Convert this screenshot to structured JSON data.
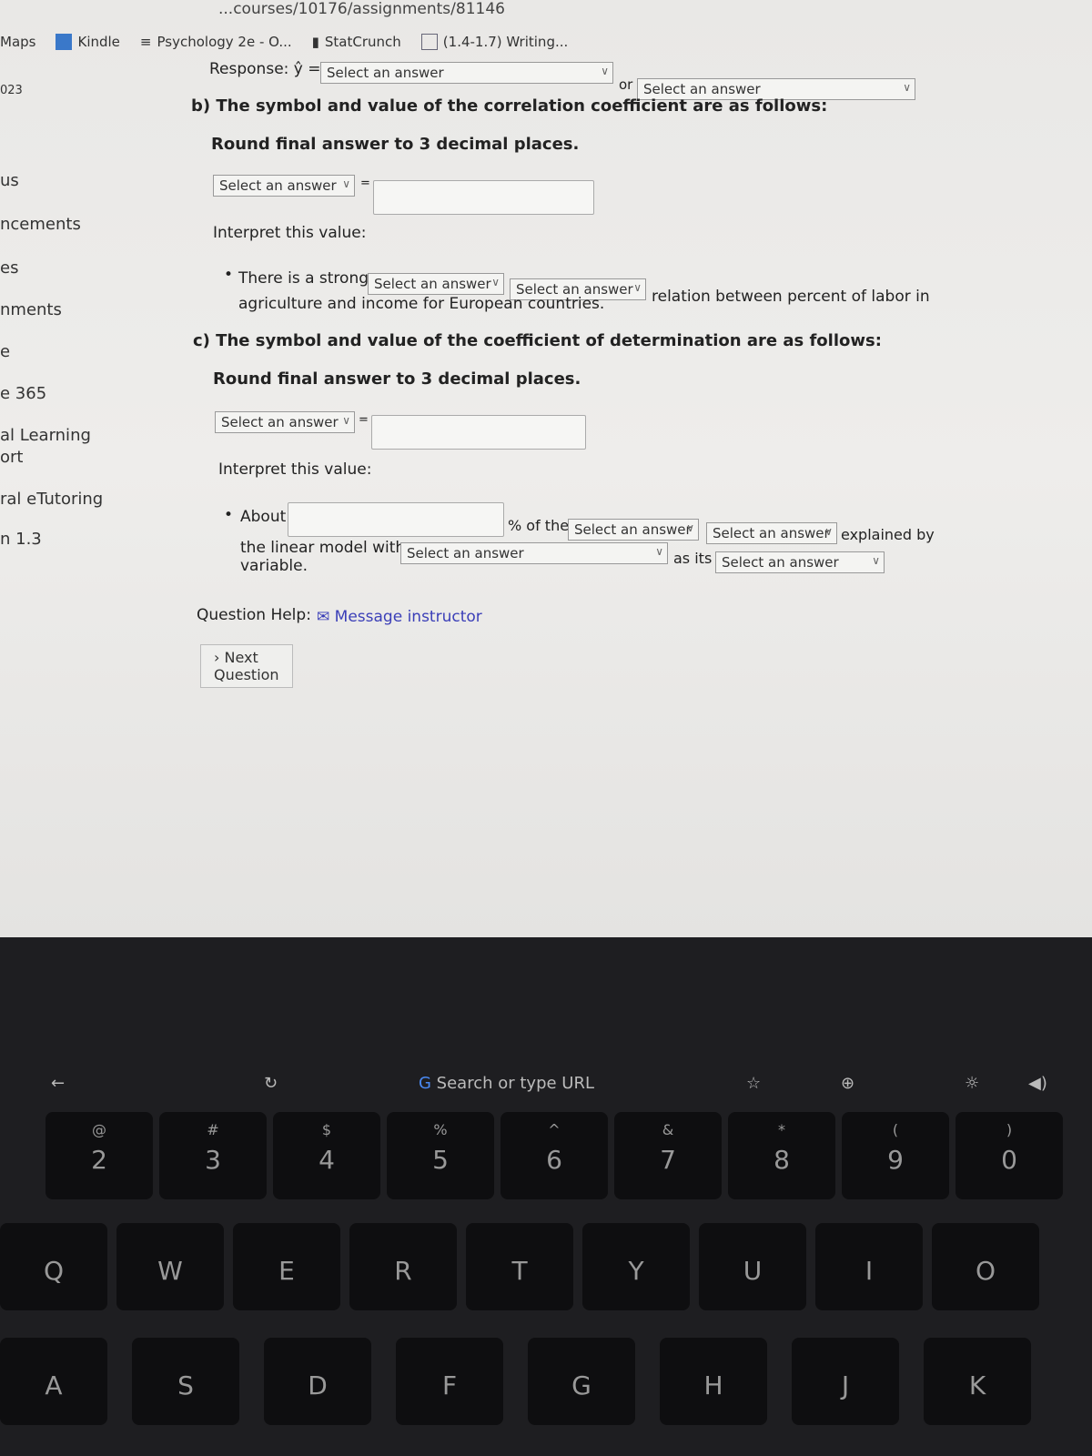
{
  "browser": {
    "url": "...courses/10176/assignments/81146",
    "bookmarks": [
      {
        "label": "Maps"
      },
      {
        "label": "Kindle"
      },
      {
        "label": "Psychology 2e - O..."
      },
      {
        "label": "StatCrunch"
      },
      {
        "label": "(1.4-1.7) Writing..."
      }
    ]
  },
  "sidebar": {
    "items": [
      "023",
      "us",
      "ncements",
      "es",
      "nments",
      "e",
      "e 365",
      "al Learning",
      "ort",
      "ral eTutoring",
      "n 1.3"
    ]
  },
  "question": {
    "response_label": "Response: ŷ =",
    "select_placeholder": "Select an answer",
    "or_text": "or",
    "part_b": {
      "heading": "b) The symbol and value of the correlation coefficient are as follows:",
      "round": "Round final answer to 3 decimal places.",
      "equals": "=",
      "interpret": "Interpret this value:",
      "bullet_pre": "There is a strong",
      "bullet_post": "relation between percent of labor in",
      "bullet_line2": "agriculture and income for European countries."
    },
    "part_c": {
      "heading": "c) The symbol and value of the coefficient of determination are as follows:",
      "round": "Round final answer to 3 decimal places.",
      "equals": "=",
      "interpret": "Interpret this value:",
      "about": "About",
      "pct_of_the": "% of the",
      "explained_by": "explained by",
      "line2_pre": "the linear model with",
      "as_its": "as its",
      "line3": "variable."
    },
    "help_label": "Question Help:",
    "message_instructor": "Message instructor",
    "next_question": "Next Question"
  },
  "touchbar": {
    "search": "Search or type URL"
  },
  "keyboard": {
    "number_row": [
      {
        "top": "@",
        "main": "2"
      },
      {
        "top": "#",
        "main": "3"
      },
      {
        "top": "$",
        "main": "4"
      },
      {
        "top": "%",
        "main": "5"
      },
      {
        "top": "^",
        "main": "6"
      },
      {
        "top": "&",
        "main": "7"
      },
      {
        "top": "*",
        "main": "8"
      },
      {
        "top": "(",
        "main": "9"
      },
      {
        "top": ")",
        "main": "0"
      }
    ],
    "letter_row": [
      "Q",
      "W",
      "E",
      "R",
      "T",
      "Y",
      "U",
      "I",
      "O"
    ],
    "home_row": [
      "A",
      "S",
      "D",
      "F",
      "G",
      "H",
      "J",
      "K"
    ]
  },
  "colors": {
    "link": "#3b3fb8",
    "screen_bg": "#eceae8",
    "keyboard_bg": "#1e1e21"
  }
}
